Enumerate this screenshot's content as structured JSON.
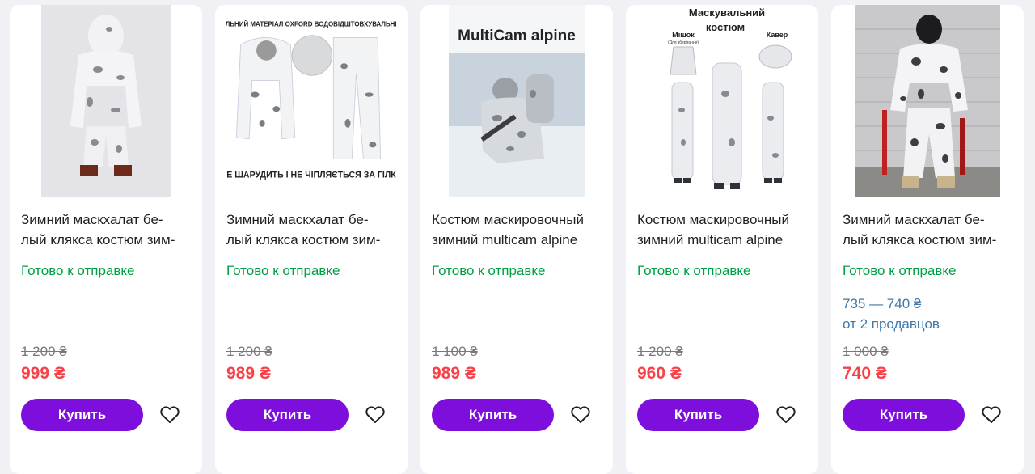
{
  "products": [
    {
      "title": "Зимний маскхалат белый клякса костюм зим-",
      "title_display": "Зимний маскхалат бе-\nлый клякса костюм зим-",
      "status": "Готово к отправке",
      "old_price": "1 200 ₴",
      "price": "999 ₴",
      "buy_label": "Купить",
      "image": "winter-camo-suit-front"
    },
    {
      "title": "Зимний маскхалат белый клякса костюм зим-",
      "title_display": "Зимний маскхалат бе-\nлый клякса костюм зим-",
      "status": "Готово к отправке",
      "old_price": "1 200 ₴",
      "price": "989 ₴",
      "buy_label": "Купить",
      "image": "winter-camo-jacket-pants",
      "image_text_top": "ЩІЛЬНИЙ МАТЕРІАЛ OXFORD ВОДОВІДШТОВХУВАЛЬНИЙ",
      "image_text_bottom": "НЕ ШАРУДИТЬ І НЕ ЧІПЛЯЄТЬСЯ ЗА ГІЛКИ"
    },
    {
      "title": "Костюм маскировочный зимний multicam alpine",
      "title_display": "Костюм маскировочный\nзимний multicam alpine",
      "status": "Готово к отправке",
      "old_price": "1 100 ₴",
      "price": "989 ₴",
      "buy_label": "Купить",
      "image": "soldier-in-snow",
      "image_text_top": "MultiCam alpine"
    },
    {
      "title": "Костюм маскировочный зимний multicam alpine",
      "title_display": "Костюм маскировочный\nзимний multicam alpine",
      "status": "Готово к отправке",
      "old_price": "1 200 ₴",
      "price": "960 ₴",
      "buy_label": "Купить",
      "image": "camo-suit-set",
      "image_text_top": "Маскувальний",
      "image_text_top2": "костюм",
      "image_label_left": "Мішок",
      "image_label_left_sub": "(Для зберігання)",
      "image_label_right": "Кавер"
    },
    {
      "title": "Зимний маскхалат белый клякса костюм зим-",
      "title_display": "Зимний маскхалат бе-\nлый клякса костюм зим-",
      "status": "Готово к отправке",
      "sellers_price": "735 — 740 ₴",
      "sellers_count": "от 2 продавцов",
      "old_price": "1 000 ₴",
      "price": "740 ₴",
      "buy_label": "Купить",
      "image": "winter-camo-suit-brick-wall"
    }
  ],
  "colors": {
    "accent": "#7e0edc",
    "price_red": "#f84147",
    "status_green": "#00a046",
    "link_blue": "#3e77aa"
  }
}
